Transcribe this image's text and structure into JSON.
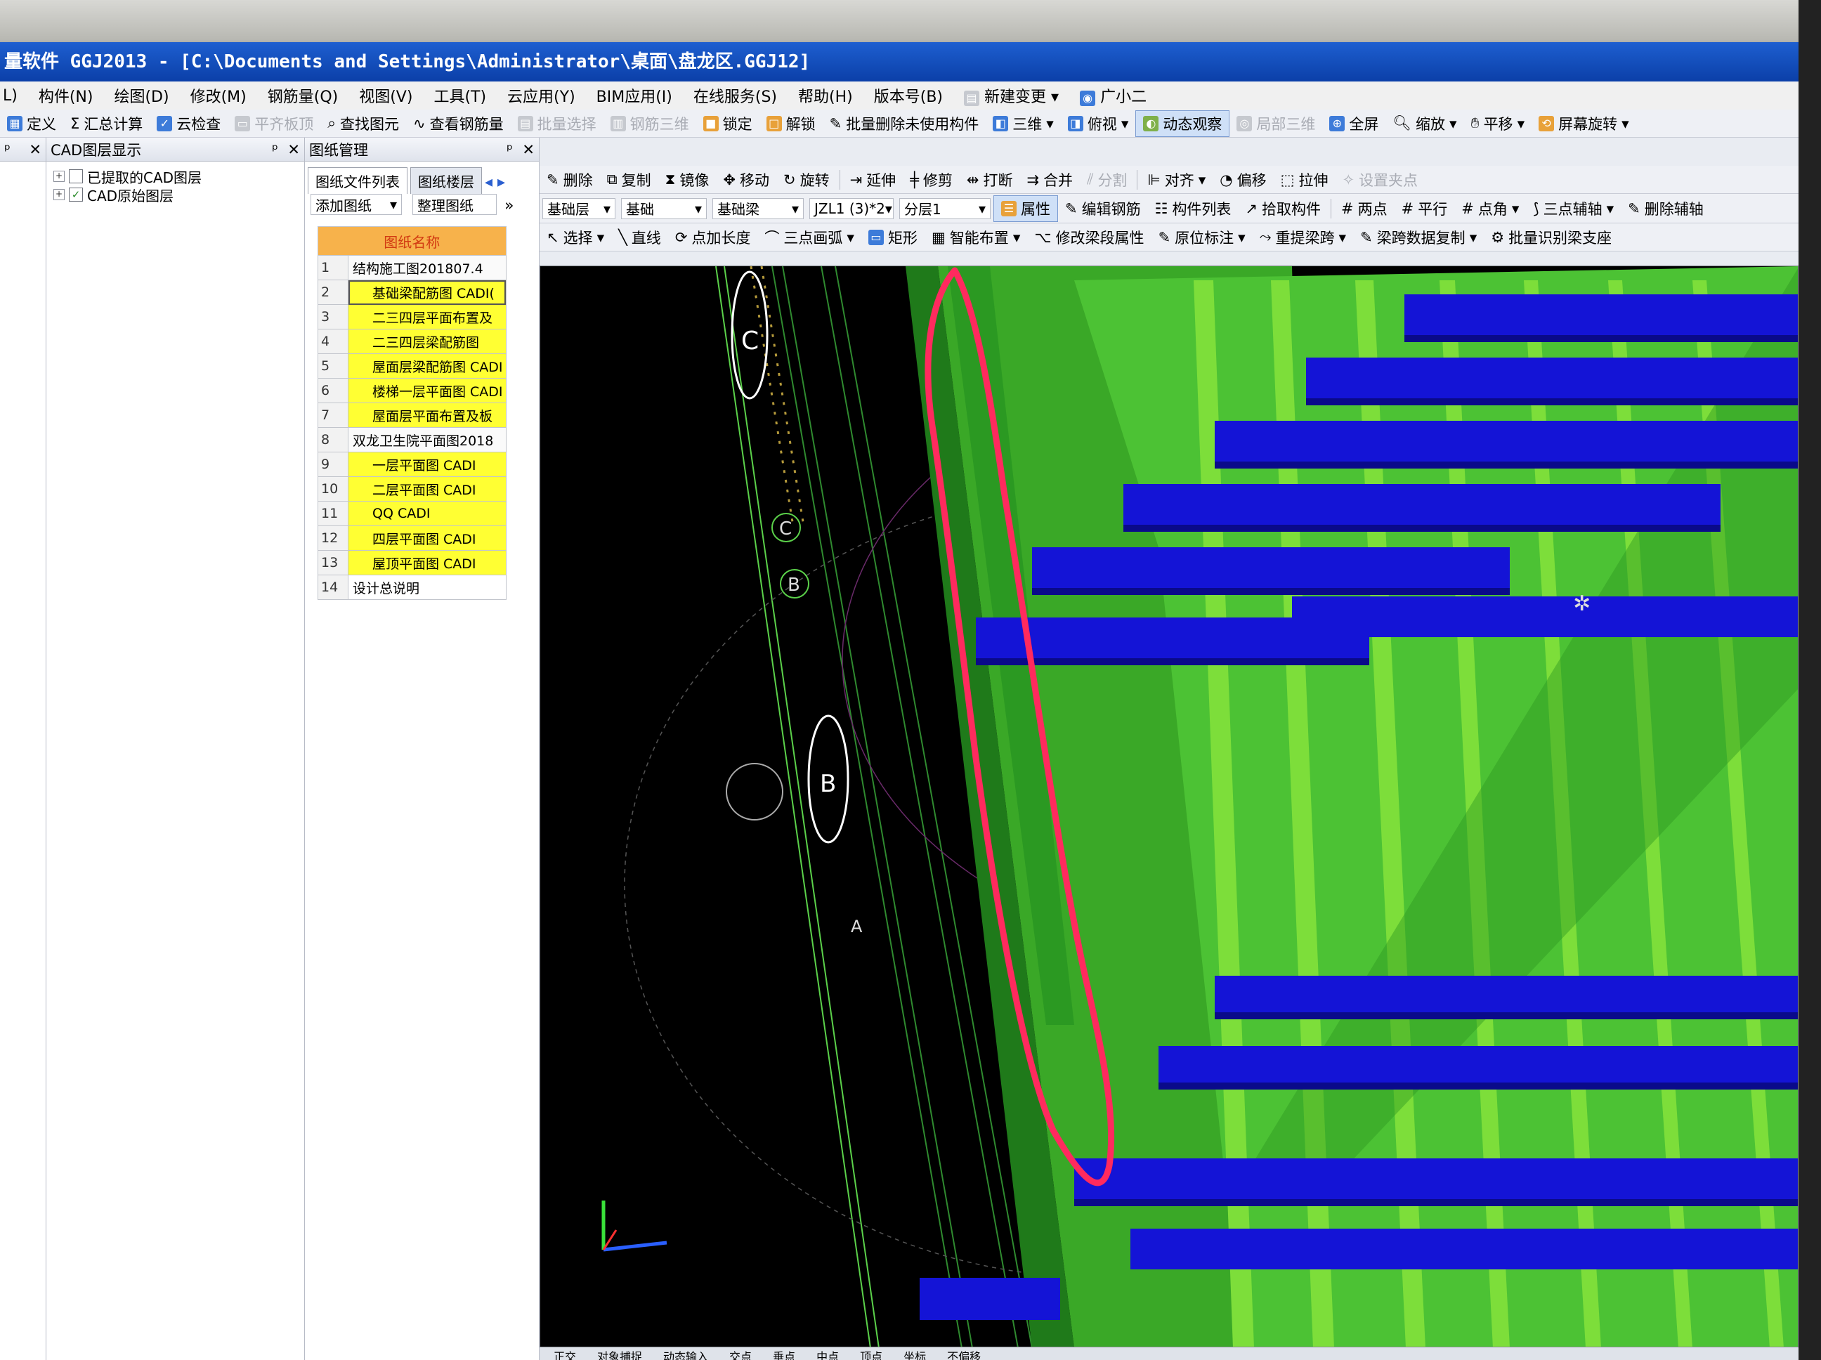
{
  "window": {
    "title": "量软件 GGJ2013 - [C:\\Documents and Settings\\Administrator\\桌面\\盘龙区.GGJ12]"
  },
  "menu": {
    "items": [
      "L)",
      "构件(N)",
      "绘图(D)",
      "修改(M)",
      "钢筋量(Q)",
      "视图(V)",
      "工具(T)",
      "云应用(Y)",
      "BIM应用(I)",
      "在线服务(S)",
      "帮助(H)",
      "版本号(B)",
      "新建变更",
      "广小二"
    ]
  },
  "toolbar1": {
    "define": "定义",
    "sum": "汇总计算",
    "cloud_check": "云检查",
    "flat_board": "平齐板顶",
    "find": "查找图元",
    "view_rebar": "查看钢筋量",
    "batch_select": "批量选择",
    "rebar_3d": "钢筋三维",
    "lock": "锁定",
    "unlock": "解锁",
    "batch_delete": "批量删除未使用构件",
    "three_d": "三维",
    "top_view": "俯视",
    "dynamic_view": "动态观察",
    "local_3d": "局部三维",
    "fullscreen": "全屏",
    "zoom": "缩放",
    "pan": "平移",
    "screen_rotate": "屏幕旋转"
  },
  "toolbar2": {
    "delete": "删除",
    "copy": "复制",
    "mirror": "镜像",
    "move": "移动",
    "rotate": "旋转",
    "extend": "延伸",
    "trim": "修剪",
    "break": "打断",
    "merge": "合并",
    "split": "分割",
    "align": "对齐",
    "offset": "偏移",
    "stretch": "拉伸",
    "set_point": "设置夹点"
  },
  "toolbar3": {
    "floor": "基础层",
    "category": "基础",
    "type": "基础梁",
    "component": "JZL1 (3)*2",
    "layer": "分层1",
    "properties": "属性",
    "edit_rebar": "编辑钢筋",
    "component_list": "构件列表",
    "pick": "拾取构件",
    "two_point": "两点",
    "parallel": "平行",
    "point_angle": "点角",
    "three_point_axis": "三点辅轴",
    "delete_axis": "删除辅轴"
  },
  "toolbar4": {
    "select": "选择",
    "line": "直线",
    "point_length": "点加长度",
    "arc": "三点画弧",
    "rect": "矩形",
    "smart_place": "智能布置",
    "edit_span": "修改梁段属性",
    "annotate": "原位标注",
    "rebeam": "重提梁跨",
    "copy_span": "梁跨数据复制",
    "batch_identify": "批量识别梁支座"
  },
  "left_tab_header": "",
  "cad_layers": {
    "title": "CAD图层显示",
    "items": [
      {
        "label": "已提取的CAD图层",
        "checked": false
      },
      {
        "label": "CAD原始图层",
        "checked": true
      }
    ]
  },
  "drawing_manager": {
    "title": "图纸管理",
    "tabs": [
      "图纸文件列表",
      "图纸楼层"
    ],
    "add_button": "添加图纸",
    "organize_button": "整理图纸",
    "column_header": "图纸名称",
    "rows": [
      {
        "num": "1",
        "name": "结构施工图201807.4",
        "kind": "group"
      },
      {
        "num": "2",
        "name": "基础梁配筋图 CADI(",
        "kind": "selected"
      },
      {
        "num": "3",
        "name": "二三四层平面布置及",
        "kind": "item"
      },
      {
        "num": "4",
        "name": "二三四层梁配筋图",
        "kind": "item"
      },
      {
        "num": "5",
        "name": "屋面层梁配筋图 CADI",
        "kind": "item"
      },
      {
        "num": "6",
        "name": "楼梯一层平面图 CADI",
        "kind": "item"
      },
      {
        "num": "7",
        "name": "屋面层平面布置及板",
        "kind": "item"
      },
      {
        "num": "8",
        "name": "双龙卫生院平面图2018",
        "kind": "group"
      },
      {
        "num": "9",
        "name": "一层平面图 CADI",
        "kind": "item"
      },
      {
        "num": "10",
        "name": "二层平面图 CADI",
        "kind": "item"
      },
      {
        "num": "11",
        "name": "QQ CADI",
        "kind": "item"
      },
      {
        "num": "12",
        "name": "四层平面图 CADI",
        "kind": "item"
      },
      {
        "num": "13",
        "name": "屋顶平面图 CADI",
        "kind": "item"
      },
      {
        "num": "14",
        "name": "设计总说明",
        "kind": "white"
      }
    ]
  },
  "viewport": {
    "axis_labels": [
      "C",
      "B",
      "B",
      "A"
    ]
  },
  "statusbar": {
    "items": [
      "正交",
      "对象捕捉",
      "动态输入",
      "交点",
      "垂点",
      "中点",
      "顶点",
      "坐标",
      "不偏移"
    ]
  },
  "colors": {
    "beam_green": "#3aa827",
    "beam_blue": "#1414d6",
    "highlight_red": "#ff2a5e",
    "table_yellow": "#ffff33",
    "header_orange": "#f7b24b"
  }
}
